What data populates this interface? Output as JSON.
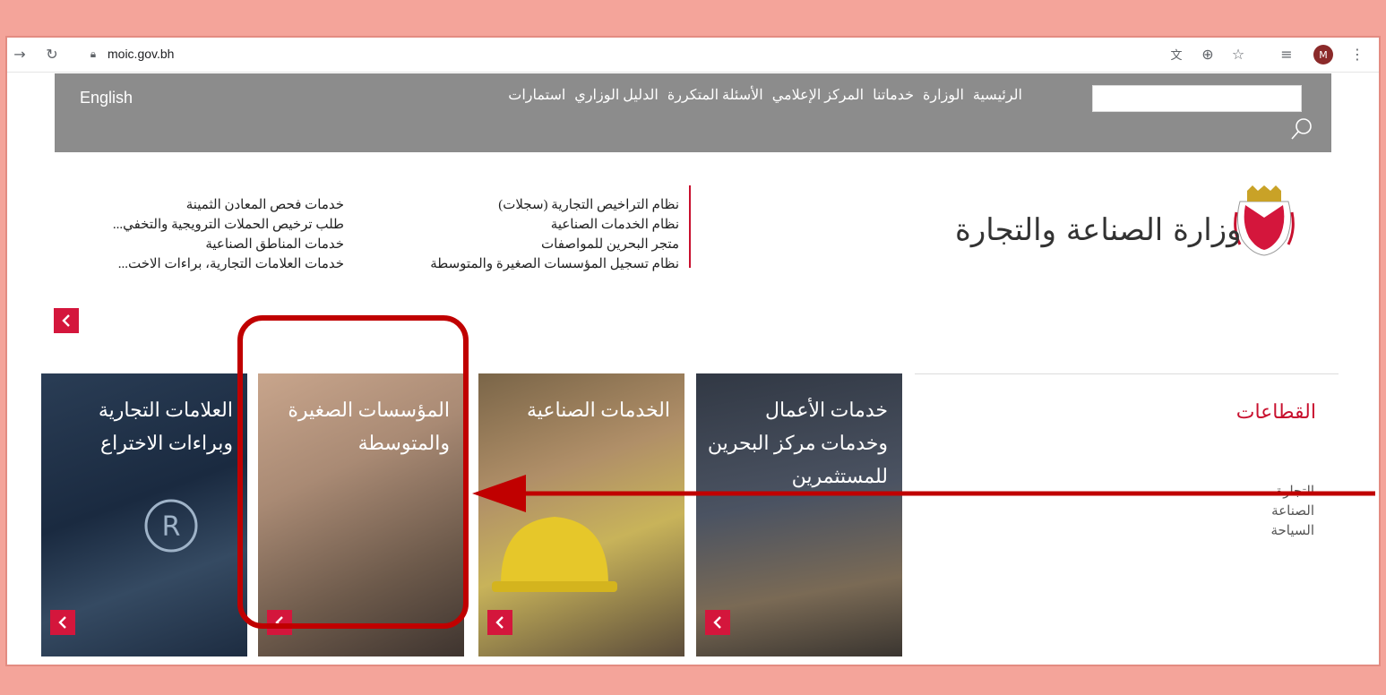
{
  "browser": {
    "url": "moic.gov.bh",
    "avatar_letter": "M"
  },
  "nav": {
    "english": "English",
    "links": [
      "الرئيسية",
      "الوزارة",
      "خدماتنا",
      "المركز الإعلامي",
      "الأسئلة المتكررة",
      "الدليل الوزاري",
      "استمارات"
    ]
  },
  "logo": {
    "text": "وزارة الصناعة والتجارة"
  },
  "services": {
    "col1": [
      "نظام التراخيص التجارية (سجلات)",
      "نظام الخدمات الصناعية",
      "متجر البحرين للمواصفات",
      "نظام تسجيل المؤسسات الصغيرة والمتوسطة"
    ],
    "col2": [
      "خدمات فحص المعادن الثمينة",
      "طلب ترخيص الحملات الترويجية والتخفي...",
      "خدمات المناطق الصناعية",
      "خدمات العلامات التجارية، براءات الاخت..."
    ]
  },
  "cards": [
    {
      "title": "العلامات التجارية وبراءات الاختراع"
    },
    {
      "title": "المؤسسات الصغيرة والمتوسطة"
    },
    {
      "title": "الخدمات الصناعية"
    },
    {
      "title": "خدمات الأعمال وخدمات مركز البحرين للمستثمرين"
    }
  ],
  "sectors": {
    "title": "القطاعات",
    "items": [
      "التجارة",
      "الصناعة",
      "السياحة"
    ]
  },
  "colors": {
    "accent": "#d4163c",
    "nav_bg": "#8c8c8c",
    "annotation": "#c00000"
  }
}
